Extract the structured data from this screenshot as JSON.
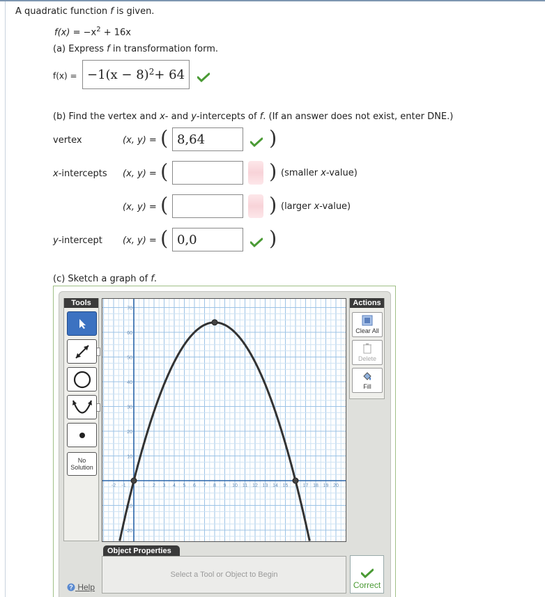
{
  "problem": {
    "intro_prefix": "A quadratic function ",
    "intro_var": "f",
    "intro_suffix": " is given.",
    "function_lhs": "f(x)",
    "function_rhs_a": "= −x",
    "function_rhs_exp": "2",
    "function_rhs_b": " + 16x"
  },
  "part_a": {
    "prompt_prefix": "(a) Express ",
    "prompt_var": "f",
    "prompt_suffix": " in transformation form.",
    "label": "f(x) =",
    "answer_main": "−1(x − 8)",
    "answer_exp": "2",
    "answer_tail": " + 64",
    "status": "correct"
  },
  "part_b": {
    "prompt": "(b) Find the vertex and x- and y-intercepts of f. (If an answer does not exist, enter DNE.)",
    "prompt_p1": "(b) Find the vertex and ",
    "prompt_x": "x",
    "prompt_p2": "- and ",
    "prompt_y": "y",
    "prompt_p3": "-intercepts of ",
    "prompt_f": "f",
    "prompt_p4": ". (If an answer does not exist, enter DNE.)",
    "xy_label": "(x, y) =",
    "rows": [
      {
        "label": "vertex",
        "value": "8,64",
        "status": "correct",
        "note": ""
      },
      {
        "label": "x-intercepts",
        "value": "",
        "status": "empty",
        "note": "(smaller x-value)"
      },
      {
        "label": "",
        "value": "",
        "status": "empty",
        "note": "(larger x-value)"
      },
      {
        "label": "y-intercept",
        "value": "0,0",
        "status": "correct",
        "note": ""
      }
    ]
  },
  "part_c": {
    "prompt_prefix": "(c) Sketch a graph of ",
    "prompt_var": "f",
    "prompt_suffix": "."
  },
  "graph_tool": {
    "tools_title": "Tools",
    "actions_title": "Actions",
    "tools": [
      "pointer-icon",
      "line-icon",
      "circle-icon",
      "parabola-icon",
      "point-icon"
    ],
    "no_solution": [
      "No",
      "Solution"
    ],
    "actions": [
      {
        "label": "Clear All",
        "icon": "clear-all-icon",
        "enabled": true
      },
      {
        "label": "Delete",
        "icon": "trash-icon",
        "enabled": false
      },
      {
        "label": "Fill",
        "icon": "fill-bucket-icon",
        "enabled": true
      }
    ],
    "object_properties_title": "Object Properties",
    "object_properties_hint": "Select a Tool or Object to Begin",
    "correct_label": "Correct",
    "help_label": "Help",
    "colors": {
      "accent": "#3c72c1",
      "check": "#4a9a34",
      "curve": "#333333",
      "grid_minor": "#cfe3f3",
      "grid_major": "#9cc3e6",
      "axis": "#2a65a8"
    }
  },
  "chart_data": {
    "type": "line",
    "xlim": [
      -3,
      21
    ],
    "ylim": [
      -25,
      72
    ],
    "x_ticks": [
      -2,
      -1,
      1,
      2,
      3,
      4,
      5,
      6,
      7,
      8,
      9,
      10,
      11,
      12,
      13,
      14,
      15,
      17,
      18,
      19,
      20
    ],
    "y_ticks": [
      70,
      60,
      50,
      40,
      30,
      20,
      10,
      -10,
      -20
    ],
    "x_tick_labels": [
      "-2",
      "-1",
      "1",
      "2",
      "3",
      "4",
      "5",
      "6",
      "7",
      "8",
      "9",
      "10",
      "11",
      "12",
      "13",
      "14",
      "15",
      "17",
      "18",
      "19",
      "20"
    ],
    "y_tick_labels": [
      "70",
      "60",
      "50",
      "40",
      "30",
      "20",
      "10",
      "-10",
      "-20"
    ],
    "series": [
      {
        "function": "-(x-8)^2+64"
      }
    ],
    "points": [
      {
        "x": 0,
        "y": 0
      },
      {
        "x": 8,
        "y": 64
      },
      {
        "x": 16,
        "y": 0
      }
    ],
    "grid": true
  }
}
